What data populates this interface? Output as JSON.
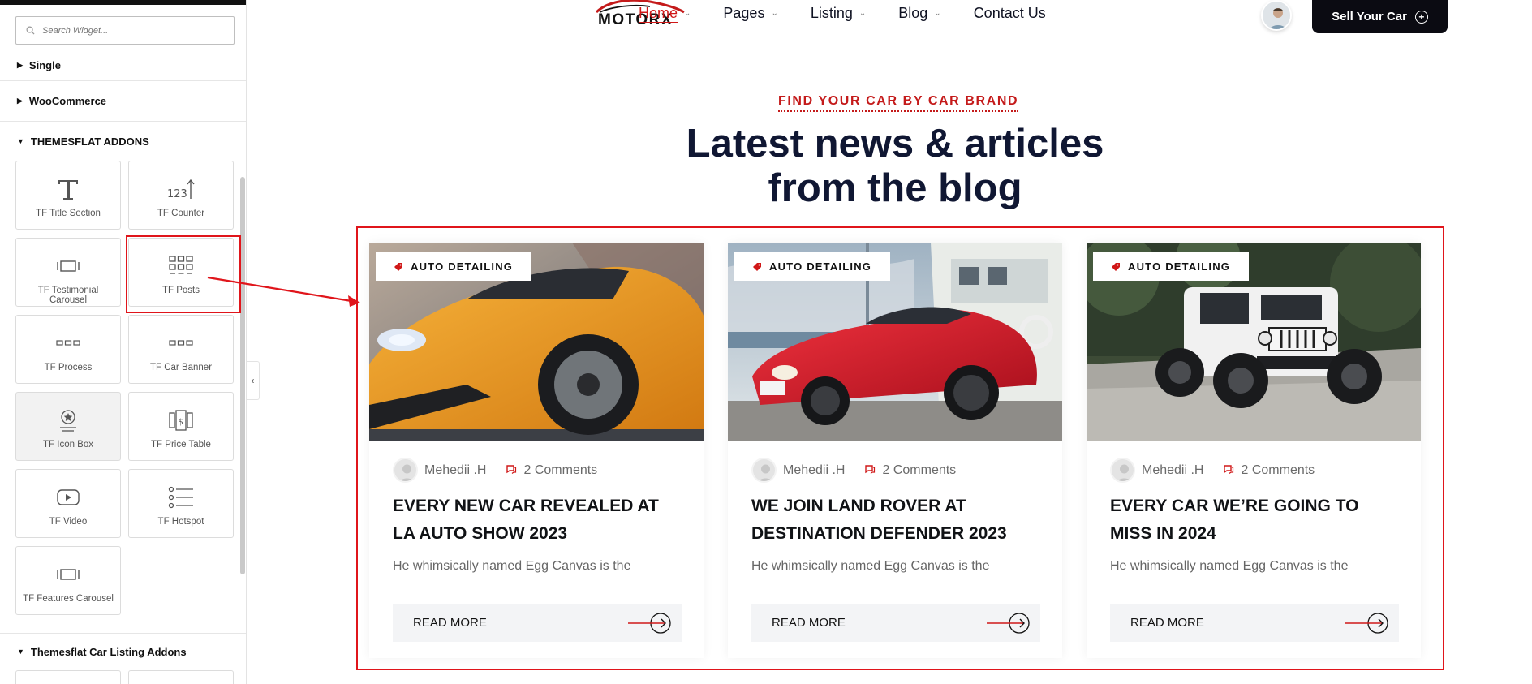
{
  "panel": {
    "search_placeholder": "Search Widget...",
    "categories": {
      "single": "Single",
      "woocommerce": "WooCommerce",
      "themesflat_addons": "THEMESFLAT ADDONS",
      "car_listing_addons": "Themesflat Car Listing Addons"
    },
    "widgets": [
      {
        "label": "TF Title Section",
        "icon": "title-icon"
      },
      {
        "label": "TF Counter",
        "icon": "counter-icon"
      },
      {
        "label": "TF Testimonial Carousel",
        "icon": "carousel-icon"
      },
      {
        "label": "TF Posts",
        "icon": "posts-grid-icon"
      },
      {
        "label": "TF Process",
        "icon": "process-icon"
      },
      {
        "label": "TF Car Banner",
        "icon": "banner-icon"
      },
      {
        "label": "TF Icon Box",
        "icon": "icon-box-icon"
      },
      {
        "label": "TF Price Table",
        "icon": "price-table-icon"
      },
      {
        "label": "TF Video",
        "icon": "video-icon"
      },
      {
        "label": "TF Hotspot",
        "icon": "hotspot-icon"
      },
      {
        "label": "TF Features Carousel",
        "icon": "carousel-icon"
      }
    ]
  },
  "header": {
    "logo_text": "MOTORX",
    "nav": [
      {
        "label": "Home"
      },
      {
        "label": "Pages"
      },
      {
        "label": "Listing"
      },
      {
        "label": "Blog"
      },
      {
        "label": "Contact Us"
      }
    ],
    "cta_label": "Sell Your Car"
  },
  "section": {
    "eyebrow": "FIND YOUR CAR BY CAR BRAND",
    "headline_line1": "Latest news & articles",
    "headline_line2": "from the blog"
  },
  "posts": [
    {
      "tag": "AUTO DETAILING",
      "author": "Mehedii .H",
      "comments": "2 Comments",
      "title": "EVERY NEW CAR REVEALED AT LA AUTO SHOW 2023",
      "excerpt": "He whimsically named Egg Canvas is the",
      "read_more": "READ MORE"
    },
    {
      "tag": "AUTO DETAILING",
      "author": "Mehedii .H",
      "comments": "2 Comments",
      "title": "WE JOIN LAND ROVER AT DESTINATION DEFENDER 2023",
      "excerpt": "He whimsically named Egg Canvas is the",
      "read_more": "READ MORE"
    },
    {
      "tag": "AUTO DETAILING",
      "author": "Mehedii .H",
      "comments": "2 Comments",
      "title": "EVERY CAR WE’RE GOING TO MISS IN 2024",
      "excerpt": "He whimsically named Egg Canvas is the",
      "read_more": "READ MORE"
    }
  ],
  "colors": {
    "accent": "#d01818",
    "highlight": "#e0151b",
    "heading": "#101733",
    "cta_bg": "#0b0b12"
  }
}
